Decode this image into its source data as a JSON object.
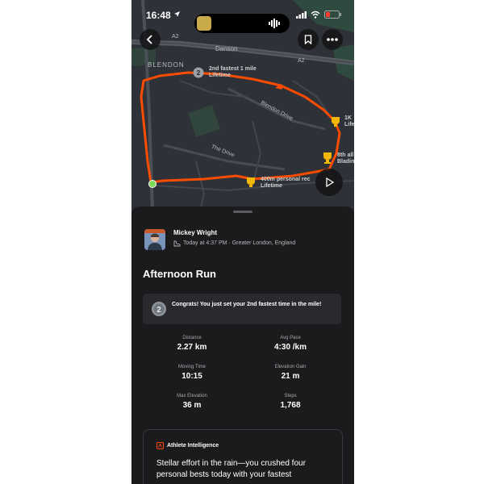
{
  "status_bar": {
    "time": "16:48"
  },
  "map": {
    "roads": {
      "a2_left": "A2",
      "a2_right": "A2",
      "danson": "Danson",
      "blendon_drive": "Blendon Drive",
      "the_drive": "The Drive"
    },
    "area_label": "BLENDON",
    "badges": [
      {
        "icon": "medal-2-icon",
        "line1": "2nd fastest 1 mile",
        "line2": "Lifetime"
      },
      {
        "icon": "trophy-pr-icon",
        "line1": "1K",
        "line2": "Life"
      },
      {
        "icon": "trophy-icon",
        "line1": "8th all",
        "line2": "Bladin"
      },
      {
        "icon": "trophy-pr-icon",
        "line1": "400m personal rec",
        "line2": "Lifetime"
      }
    ],
    "colors": {
      "route": "#fc4c02",
      "background": "#2e3137",
      "start": "#7ed957"
    }
  },
  "activity": {
    "athlete_name": "Mickey Wright",
    "meta": "Today at 4:37 PM · Greater London, England",
    "title": "Afternoon Run",
    "congrats": "Congrats! You just set your 2nd fastest time in the mile!",
    "stats": [
      {
        "label": "Distance",
        "value": "2.27 km"
      },
      {
        "label": "Avg Pace",
        "value": "4:30 /km"
      },
      {
        "label": "Moving Time",
        "value": "10:15"
      },
      {
        "label": "Elevation Gain",
        "value": "21 m"
      },
      {
        "label": "Max Elevation",
        "value": "36 m"
      },
      {
        "label": "Steps",
        "value": "1,768"
      }
    ]
  },
  "athlete_intelligence": {
    "heading": "Athlete Intelligence",
    "body": "Stellar effort in the rain—you crushed four personal bests today with your fastest"
  }
}
